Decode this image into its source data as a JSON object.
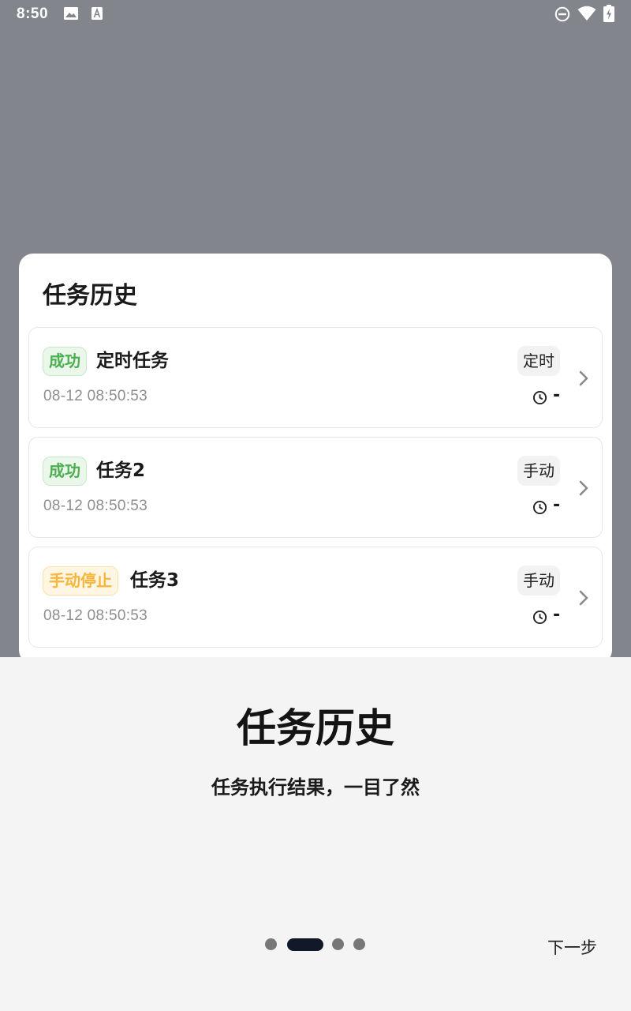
{
  "status_bar": {
    "time": "8:50",
    "icons": [
      "image-icon",
      "text-a-icon",
      "do-not-disturb-icon",
      "wifi-icon",
      "battery-charging-icon"
    ]
  },
  "card": {
    "title": "任务历史",
    "tasks": [
      {
        "status": "成功",
        "status_type": "success",
        "name": "定时任务",
        "tag": "定时",
        "time": "08-12 08:50:53",
        "duration": "-"
      },
      {
        "status": "成功",
        "status_type": "success",
        "name": "任务2",
        "tag": "手动",
        "time": "08-12 08:50:53",
        "duration": "-"
      },
      {
        "status": "手动停止",
        "status_type": "stopped",
        "name": "任务3",
        "tag": "手动",
        "time": "08-12 08:50:53",
        "duration": "-"
      }
    ]
  },
  "onboarding": {
    "title": "任务历史",
    "subtitle": "任务执行结果，一目了然",
    "page_index": 2,
    "page_count": 4,
    "next_label": "下一步"
  },
  "colors": {
    "success": "#4caf50",
    "stopped": "#f7b53a",
    "active_dot": "#111827",
    "backdrop": "#83858d"
  }
}
